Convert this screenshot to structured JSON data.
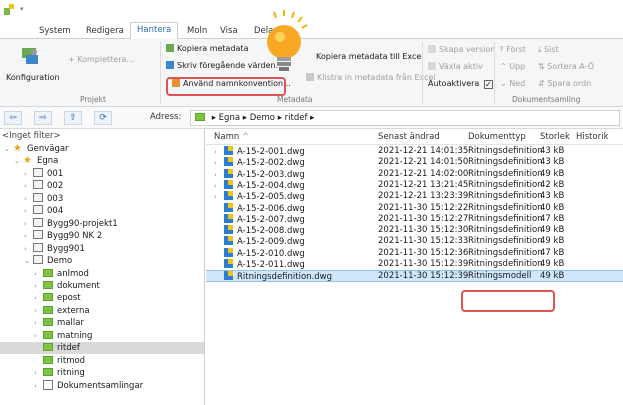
{
  "ribbon_tabs": [
    "System",
    "Redigera",
    "Hantera",
    "Moln",
    "Visa",
    "Dela"
  ],
  "active_tab": "Hantera",
  "ribbon": {
    "konfiguration": "Konfiguration",
    "komplettera": "Komplettera...",
    "projekt_group": "Projekt",
    "kopiera_metadata": "Kopiera metadata",
    "skriv_foregaende": "Skriv föregående värden...",
    "anvand_namnkonvention": "Använd namnkonvention...",
    "kopiera_till_excel": "Kopiera metadata till Excel",
    "klistra_fran_excel": "Klistra in metadata från Excel",
    "metadata_group": "Metadata",
    "skapa_version": "Skapa version",
    "vaxla_aktiv": "Växla aktiv",
    "autoaktivera": "Autoaktivera",
    "forst": "Först",
    "sist": "Sist",
    "upp": "Upp",
    "ned": "Ned",
    "sortera": "Sortera A-Ö",
    "spara_ordn": "Spara ordn",
    "dokumentsamling_group": "Dokumentsamling"
  },
  "address": {
    "label": "Adress:",
    "path": [
      "Egna",
      "Demo",
      "ritdef"
    ]
  },
  "tree": {
    "filter": "<Inget filter>",
    "items": [
      {
        "label": "Genvägar",
        "type": "star",
        "depth": 0,
        "chevron": "down"
      },
      {
        "label": "Egna",
        "type": "star",
        "depth": 1,
        "chevron": "down"
      },
      {
        "label": "001",
        "type": "proj",
        "depth": 2,
        "chevron": "right"
      },
      {
        "label": "002",
        "type": "proj",
        "depth": 2,
        "chevron": "right"
      },
      {
        "label": "003",
        "type": "proj",
        "depth": 2,
        "chevron": "right"
      },
      {
        "label": "004",
        "type": "proj",
        "depth": 2,
        "chevron": "right"
      },
      {
        "label": "Bygg90-projekt1",
        "type": "proj",
        "depth": 2,
        "chevron": "right"
      },
      {
        "label": "Bygg90 NK 2",
        "type": "proj",
        "depth": 2,
        "chevron": "right"
      },
      {
        "label": "Bygg901",
        "type": "proj",
        "depth": 2,
        "chevron": "right"
      },
      {
        "label": "Demo",
        "type": "proj",
        "depth": 2,
        "chevron": "down"
      },
      {
        "label": "anlmod",
        "type": "folder",
        "depth": 3,
        "chevron": "right"
      },
      {
        "label": "dokument",
        "type": "folder",
        "depth": 3,
        "chevron": "right"
      },
      {
        "label": "epost",
        "type": "folder",
        "depth": 3,
        "chevron": "right"
      },
      {
        "label": "externa",
        "type": "folder",
        "depth": 3,
        "chevron": "right"
      },
      {
        "label": "mallar",
        "type": "folder",
        "depth": 3,
        "chevron": "right"
      },
      {
        "label": "matning",
        "type": "folder",
        "depth": 3,
        "chevron": "right"
      },
      {
        "label": "ritdef",
        "type": "folder",
        "depth": 3,
        "chevron": "",
        "selected": true
      },
      {
        "label": "ritmod",
        "type": "folder",
        "depth": 3,
        "chevron": ""
      },
      {
        "label": "ritning",
        "type": "folder",
        "depth": 3,
        "chevron": "right"
      },
      {
        "label": "Dokumentsamlingar",
        "type": "doc",
        "depth": 3,
        "chevron": "right"
      }
    ]
  },
  "list": {
    "headers": {
      "name": "Namn",
      "changed": "Senast ändrad",
      "doctype": "Dokumenttyp",
      "size": "Storlek",
      "history": "Historik"
    },
    "rows": [
      {
        "name": "A-15-2-001.dwg",
        "changed": "2021-12-21 14:01:35",
        "doctype": "Ritningsdefinition",
        "size": "43 kB",
        "chevron": true
      },
      {
        "name": "A-15-2-002.dwg",
        "changed": "2021-12-21 14:01:50",
        "doctype": "Ritningsdefinition",
        "size": "43 kB",
        "chevron": true
      },
      {
        "name": "A-15-2-003.dwg",
        "changed": "2021-12-21 14:02:00",
        "doctype": "Ritningsdefinition",
        "size": "49 kB",
        "chevron": true
      },
      {
        "name": "A-15-2-004.dwg",
        "changed": "2021-12-21 13:21:45",
        "doctype": "Ritningsdefinition",
        "size": "42 kB",
        "chevron": true
      },
      {
        "name": "A-15-2-005.dwg",
        "changed": "2021-12-21 13:23:39",
        "doctype": "Ritningsdefinition",
        "size": "43 kB",
        "chevron": true
      },
      {
        "name": "A-15-2-006.dwg",
        "changed": "2021-11-30 15:12:22",
        "doctype": "Ritningsdefinition",
        "size": "40 kB",
        "chevron": false
      },
      {
        "name": "A-15-2-007.dwg",
        "changed": "2021-11-30 15:12:27",
        "doctype": "Ritningsdefinition",
        "size": "47 kB",
        "chevron": false
      },
      {
        "name": "A-15-2-008.dwg",
        "changed": "2021-11-30 15:12:30",
        "doctype": "Ritningsdefinition",
        "size": "49 kB",
        "chevron": false
      },
      {
        "name": "A-15-2-009.dwg",
        "changed": "2021-11-30 15:12:33",
        "doctype": "Ritningsdefinition",
        "size": "49 kB",
        "chevron": false
      },
      {
        "name": "A-15-2-010.dwg",
        "changed": "2021-11-30 15:12:36",
        "doctype": "Ritningsdefinition",
        "size": "47 kB",
        "chevron": false
      },
      {
        "name": "A-15-2-011.dwg",
        "changed": "2021-11-30 15:12:39",
        "doctype": "Ritningsdefinition",
        "size": "49 kB",
        "chevron": false
      },
      {
        "name": "Ritningsdefinition.dwg",
        "changed": "2021-11-30 15:12:39",
        "doctype": "Ritningsmodell",
        "size": "49 kB",
        "chevron": false,
        "selected": true
      }
    ]
  },
  "colors": {
    "accent": "#2e6db4",
    "highlight": "#e15454",
    "selection": "#cfe6fb",
    "folder": "#7dc443"
  }
}
